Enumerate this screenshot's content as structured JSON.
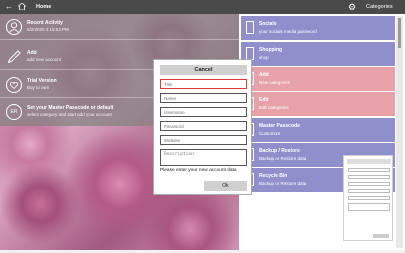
{
  "titlebar": {
    "back_icon": "arrow-left-icon",
    "home_label": "Home",
    "categories_label": "Categories"
  },
  "left_rows": [
    {
      "icon": "person-icon",
      "title": "Recent Activity",
      "subtitle": "5/2/2020 3:15:53 PM"
    },
    {
      "icon": "pencil-icon",
      "title": "Add",
      "subtitle": "add new account"
    },
    {
      "icon": "heart-icon",
      "title": "Trial Version",
      "subtitle": "Buy to own"
    },
    {
      "icon": "passcode-icon",
      "icon_text": "ER",
      "title": "Set your Master Passcode or default",
      "subtitle": "select category and start add your account"
    }
  ],
  "tiles": [
    {
      "title": "Socials",
      "subtitle": "your socials media password",
      "color": "#8f8fcc"
    },
    {
      "title": "Shopping",
      "subtitle": "shop",
      "color": "#8f8fcc"
    },
    {
      "title": "Add",
      "subtitle": "New categories",
      "color": "#e7a2a9"
    },
    {
      "title": "Edit",
      "subtitle": "Edit categories",
      "color": "#e7a2a9"
    },
    {
      "title": "Master Passcode",
      "subtitle": "Customize",
      "color": "#8f8fcc"
    },
    {
      "title": "Backup / Restore",
      "subtitle": "Backup or Restore data",
      "color": "#8f8fcc"
    },
    {
      "title": "Recycle Bin",
      "subtitle": "Backup or Restore data",
      "color": "#8f8fcc"
    }
  ],
  "dialog": {
    "cancel_label": "Cancel",
    "fields": [
      {
        "placeholder": "Title",
        "error": true
      },
      {
        "placeholder": "Name"
      },
      {
        "placeholder": "Username"
      },
      {
        "placeholder": "Password"
      },
      {
        "placeholder": "Website"
      },
      {
        "placeholder": "Description"
      }
    ],
    "message": "Please enter your new account data",
    "ok_label": "Ok"
  }
}
